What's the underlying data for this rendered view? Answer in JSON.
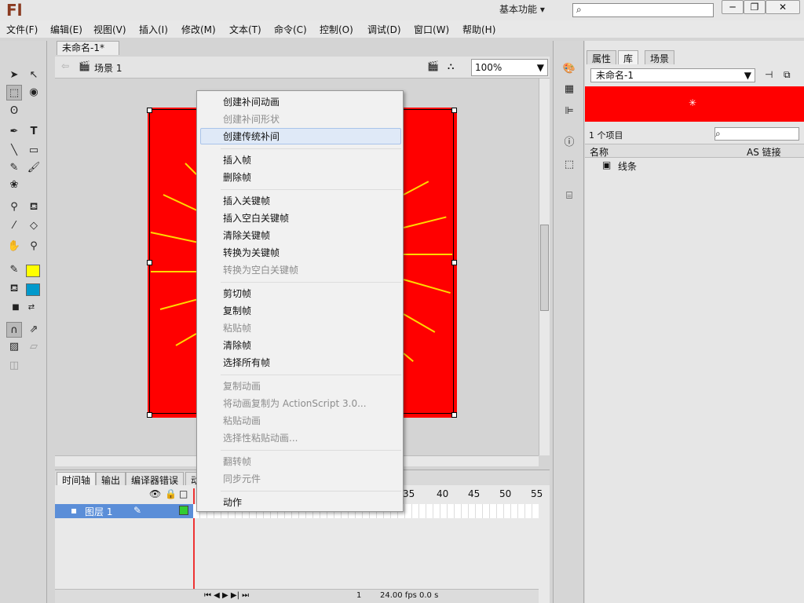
{
  "app": {
    "logo": "Fl",
    "workspace": "基本功能 ▾"
  },
  "menu": [
    "文件(F)",
    "编辑(E)",
    "视图(V)",
    "插入(I)",
    "修改(M)",
    "文本(T)",
    "命令(C)",
    "控制(O)",
    "调试(D)",
    "窗口(W)",
    "帮助(H)"
  ],
  "document": {
    "tab": "未命名-1*",
    "close": "×",
    "scene": "场景 1",
    "zoom": "100%"
  },
  "timeline": {
    "tabs": [
      "时间轴",
      "输出",
      "编译器错误",
      "动"
    ],
    "layer": "图层 1",
    "frames": [
      "35",
      "40",
      "45",
      "50",
      "55"
    ],
    "fps": "24.00 fps",
    "time": "0.0 s",
    "current_frame": "1"
  },
  "library": {
    "tabs": [
      "属性",
      "库",
      "场景"
    ],
    "doc": "未命名-1",
    "count": "1 个项目",
    "col_name": "名称",
    "col_linkage": "AS 链接",
    "item": "线条"
  },
  "context_menu": {
    "items": [
      {
        "label": "创建补间动画",
        "disabled": false
      },
      {
        "label": "创建补间形状",
        "disabled": true
      },
      {
        "label": "创建传统补间",
        "disabled": false
      },
      {
        "label": "插入帧",
        "disabled": false
      },
      {
        "label": "删除帧",
        "disabled": false
      },
      {
        "label": "插入关键帧",
        "disabled": false
      },
      {
        "label": "插入空白关键帧",
        "disabled": false
      },
      {
        "label": "清除关键帧",
        "disabled": false
      },
      {
        "label": "转换为关键帧",
        "disabled": false
      },
      {
        "label": "转换为空白关键帧",
        "disabled": true
      },
      {
        "label": "剪切帧",
        "disabled": false
      },
      {
        "label": "复制帧",
        "disabled": false
      },
      {
        "label": "粘贴帧",
        "disabled": true
      },
      {
        "label": "清除帧",
        "disabled": false
      },
      {
        "label": "选择所有帧",
        "disabled": false
      },
      {
        "label": "复制动画",
        "disabled": true
      },
      {
        "label": "将动画复制为 ActionScript 3.0...",
        "disabled": true
      },
      {
        "label": "粘贴动画",
        "disabled": true
      },
      {
        "label": "选择性粘贴动画...",
        "disabled": true
      },
      {
        "label": "翻转帧",
        "disabled": true
      },
      {
        "label": "同步元件",
        "disabled": true
      },
      {
        "label": "动作",
        "disabled": false
      }
    ],
    "highlighted": "创建传统补间"
  },
  "colors": {
    "stage_fill": "#ff0000",
    "ray": "#ffd700",
    "stroke_swatch": "#ffff00",
    "fill_swatch": "#0099cc",
    "layer_highlight": "#5b8ed8"
  }
}
